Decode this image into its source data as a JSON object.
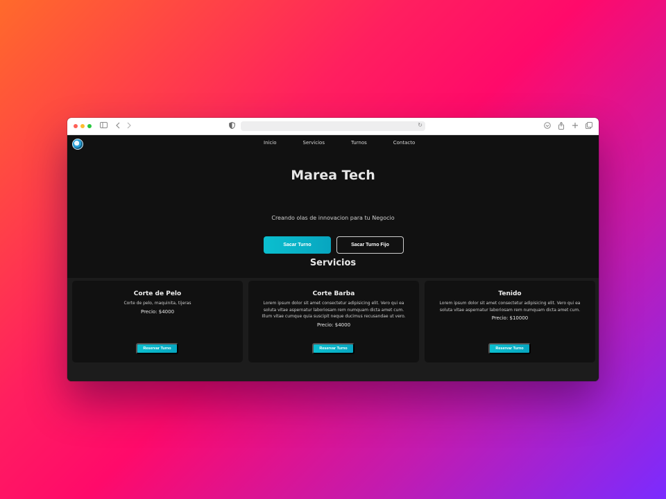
{
  "browser": {
    "address_url": "",
    "icons": [
      "sidebar-icon",
      "back-icon",
      "forward-icon",
      "privacy-shield-icon",
      "reload-icon",
      "download-icon",
      "share-icon",
      "new-tab-icon",
      "tab-overview-icon"
    ]
  },
  "nav": {
    "logo_icon": "marea-tech-logo",
    "links": [
      {
        "label": "Inicio"
      },
      {
        "label": "Servicios"
      },
      {
        "label": "Turnos"
      },
      {
        "label": "Contacto"
      }
    ]
  },
  "hero": {
    "title": "Marea Tech",
    "subtitle": "Creando olas de innovacion para tu Negocio",
    "primary_button": "Sacar Turno",
    "secondary_button": "Sacar Turno Fijo"
  },
  "services": {
    "title": "Servicios",
    "cards": [
      {
        "title": "Corte de Pelo",
        "description": "Corte de pelo, maquinita, tijeras",
        "price": "Precio: $4000",
        "button": "Reservar Turno"
      },
      {
        "title": "Corte Barba",
        "description": "Lorem ipsum dolor sit amet consectetur adipisicing elit. Vero qui ea soluta vitae aspernatur laboriosam rem numquam dicta amet cum. Illum vitae cumque quia suscipit neque ducimus recusandae ut vero.",
        "price": "Precio: $4000",
        "button": "Reservar Turno"
      },
      {
        "title": "Tenido",
        "description": "Lorem ipsum dolor sit amet consectetur adipisicing elit. Vero qui ea soluta vitae aspernatur laboriosam rem numquam dicta amet cum.",
        "price": "Precio: $10000",
        "button": "Reservar Turno"
      }
    ]
  },
  "colors": {
    "accent": "#0bbfcf",
    "page_background": "#111111",
    "surface": "#1c1c1c"
  }
}
